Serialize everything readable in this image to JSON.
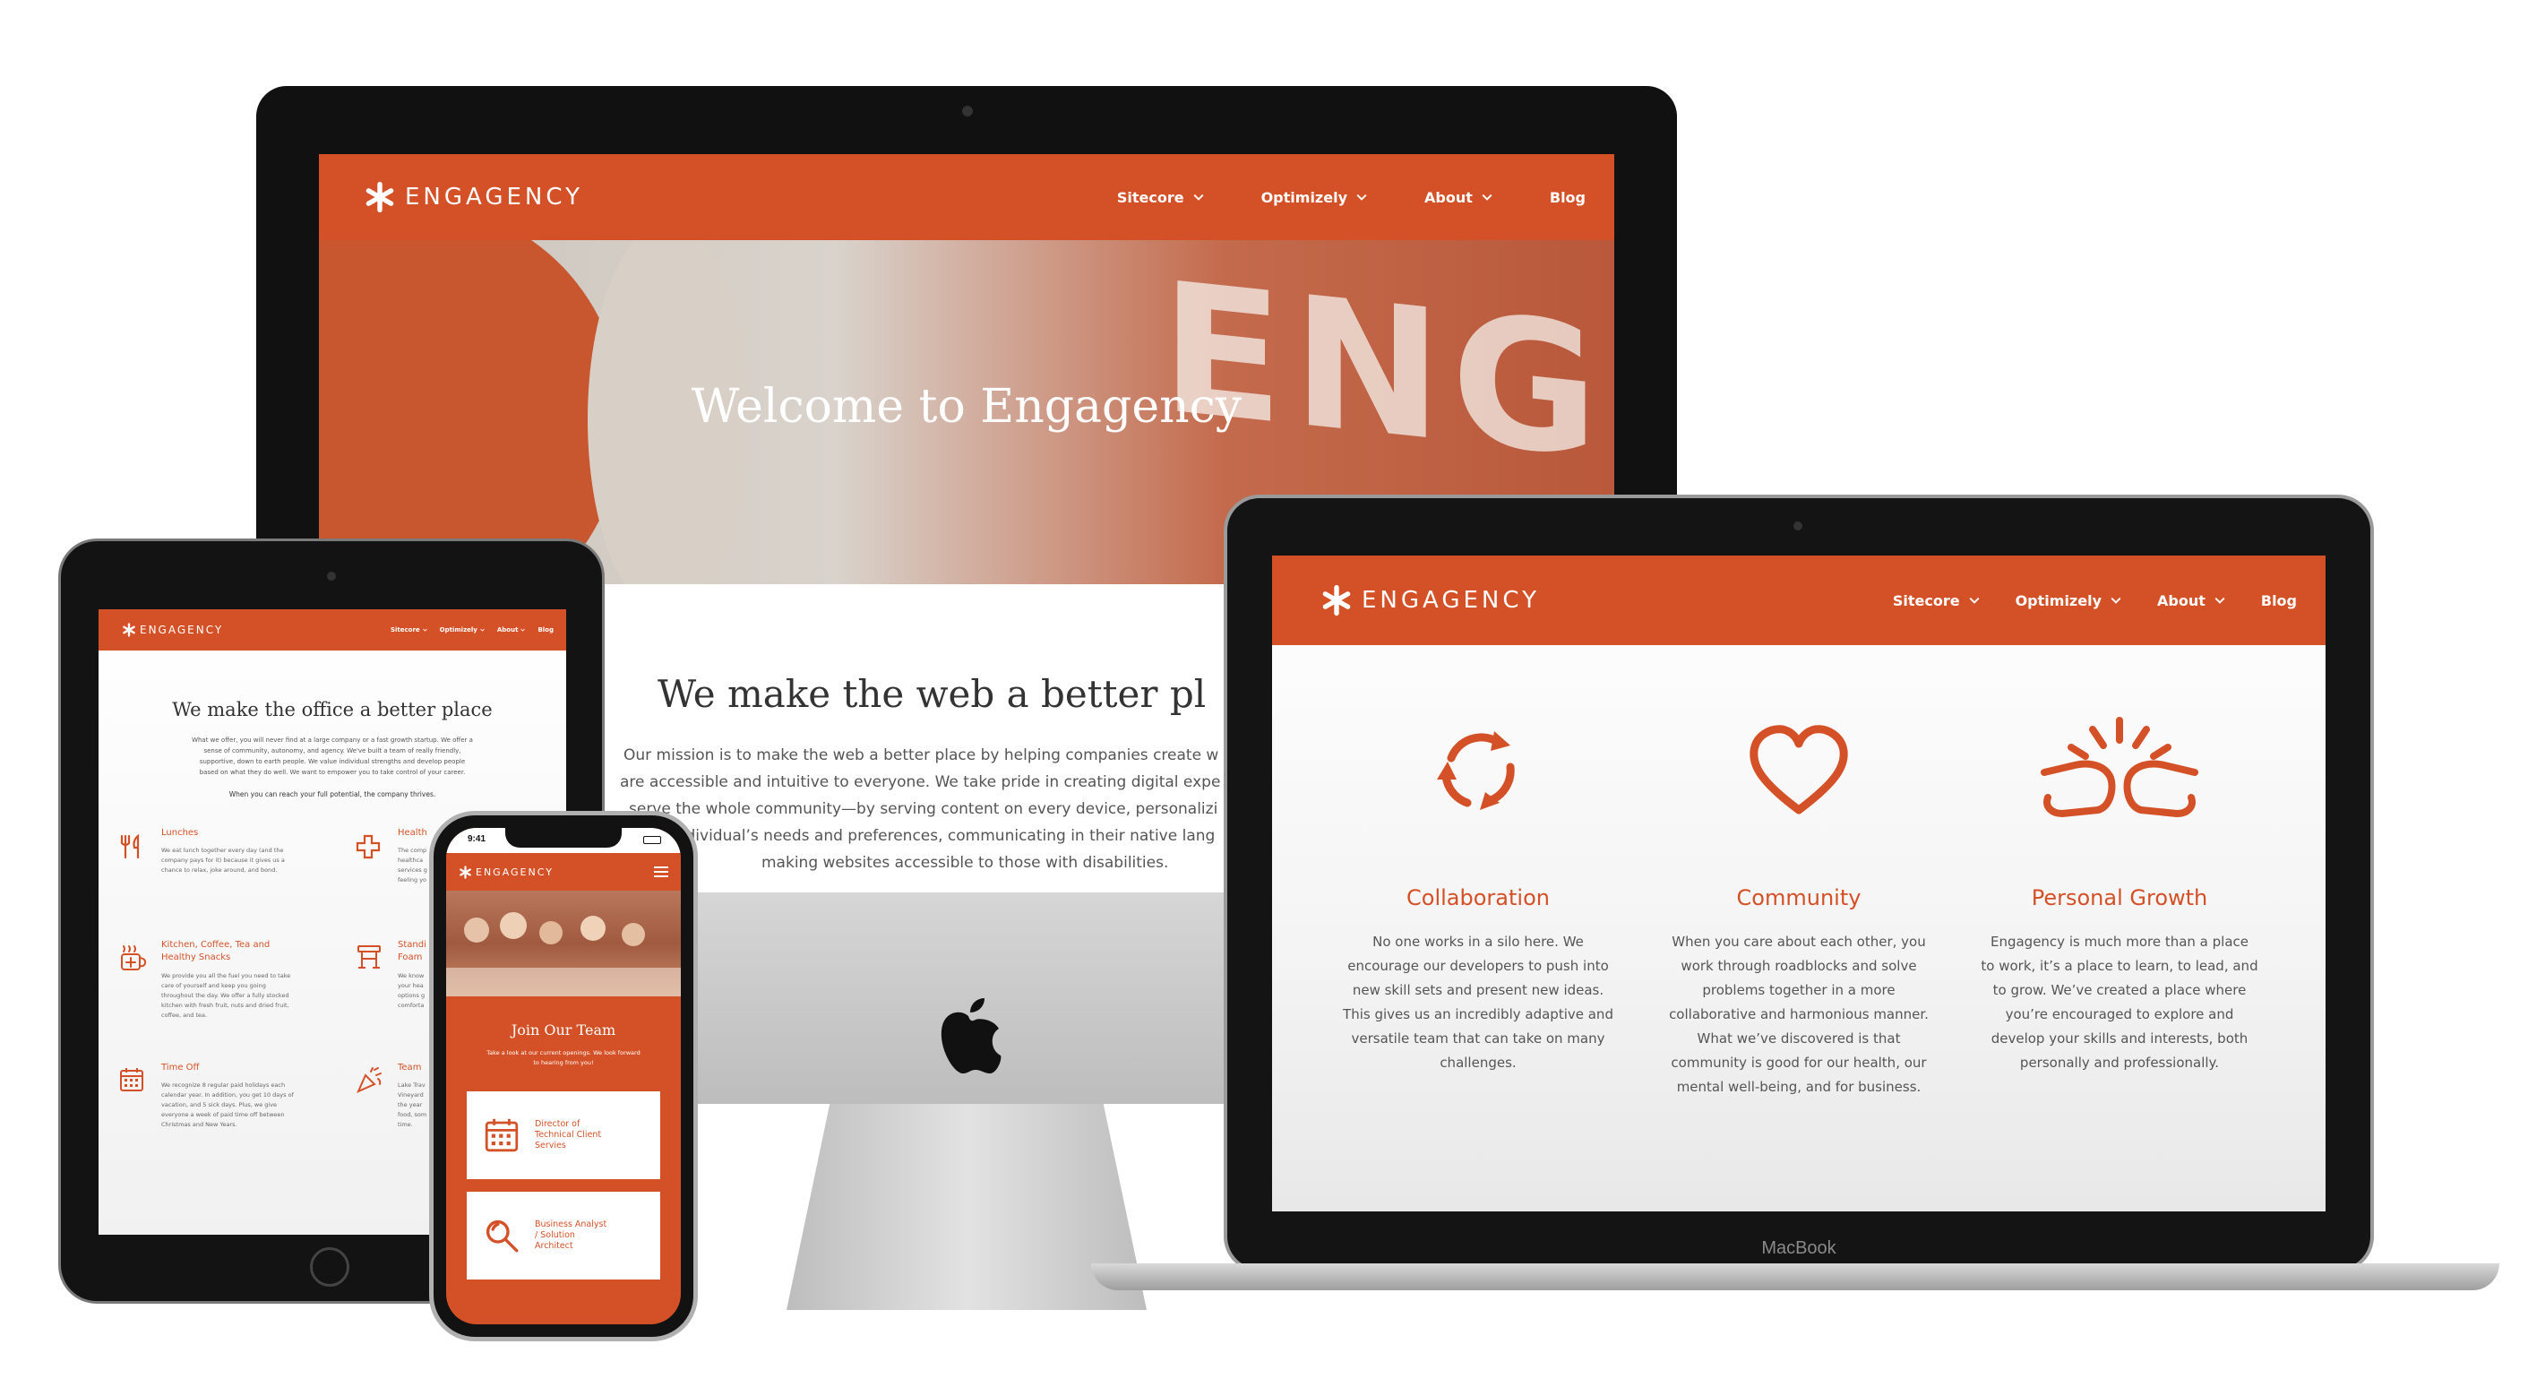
{
  "brand": {
    "name": "ENGAGENCY",
    "accent": "#d45127"
  },
  "desktop": {
    "nav": [
      {
        "label": "Sitecore",
        "dropdown": true
      },
      {
        "label": "Optimizely",
        "dropdown": true
      },
      {
        "label": "About",
        "dropdown": true
      },
      {
        "label": "Blog",
        "dropdown": false
      }
    ],
    "hero_title": "Welcome to Engagency",
    "section_title": "We make the web a better pl",
    "paragraph_lines": [
      "Our mission is to make the web a better place by helping companies create w",
      "are accessible and intuitive to everyone. We take pride in creating digital expe",
      "serve the whole community—by serving content on every device, personalizi",
      "individual’s needs and preferences, communicating in their native lang",
      "making websites accessible to those with disabilities."
    ]
  },
  "laptop": {
    "nav": [
      {
        "label": "Sitecore",
        "dropdown": true
      },
      {
        "label": "Optimizely",
        "dropdown": true
      },
      {
        "label": "About",
        "dropdown": true
      },
      {
        "label": "Blog",
        "dropdown": false
      }
    ],
    "brand_label": "MacBook",
    "features": [
      {
        "icon": "collaboration-icon",
        "title": "Collaboration",
        "text": "No one works in a silo here. We\nencourage our developers to push into\nnew skill sets and present new ideas.\nThis gives us an incredibly adaptive and\nversatile team that can take on many\nchallenges."
      },
      {
        "icon": "heart-icon",
        "title": "Community",
        "text": "When you care about each other, you\nwork through roadblocks and solve\nproblems together in a more\ncollaborative and harmonious manner.\nWhat we’ve discovered is that\ncommunity is good for our health, our\nmental well-being, and for business."
      },
      {
        "icon": "fist-bump-icon",
        "title": "Personal Growth",
        "text": "Engagency is much more than a place\nto work, it’s a place to learn, to lead, and\nto grow. We’ve created a place where\nyou’re encouraged to explore and\ndevelop your skills and interests, both\npersonally and professionally."
      }
    ]
  },
  "tablet": {
    "nav": [
      {
        "label": "Sitecore",
        "dropdown": true
      },
      {
        "label": "Optimizely",
        "dropdown": true
      },
      {
        "label": "About",
        "dropdown": true
      },
      {
        "label": "Blog",
        "dropdown": false
      }
    ],
    "title": "We make the office a better place",
    "intro": "What we offer, you will never find at a large company or a fast growth startup. We offer a\nsense of community, autonomy, and agency. We've built a team of really friendly,\nsupportive, down to earth people. We value individual strengths and develop people\nbased on what they do well. We want to empower you to take control of your career.",
    "tagline": "When you can reach your full potential, the company thrives.",
    "items_left": [
      {
        "icon": "utensils-icon",
        "title": "Lunches",
        "desc": "We eat lunch together every day (and the\ncompany pays for it) because it gives us a\nchance to relax, joke around, and bond."
      },
      {
        "icon": "coffee-icon",
        "title": "Kitchen, Coffee, Tea and\nHealthy Snacks",
        "desc": "We provide you all the fuel you need to take\ncare of yourself and keep you going\nthroughout the day. We offer a fully stocked\nkitchen with fresh fruit, nuts and dried fruit,\ncoffee, and tea."
      },
      {
        "icon": "calendar-icon",
        "title": "Time Off",
        "desc": "We recognize 8 regular paid holidays each\ncalendar year. In addition, you get 10 days of\nvacation, and 5 sick days. Plus, we give\neveryone a week of paid time off between\nChristmas and New Years."
      }
    ],
    "items_right": [
      {
        "icon": "health-cross-icon",
        "title": "Health",
        "desc": "The comp\nhealthca\nservices g\nfeeling yo"
      },
      {
        "icon": "standing-desk-icon",
        "title": "Standi\nFoam",
        "desc": "We know\nyour hea\noptions g\ncomforta"
      },
      {
        "icon": "party-popper-icon",
        "title": "Team",
        "desc": "Lake Trav\nVineyard\nthe year\nfood, som\ntime."
      }
    ]
  },
  "phone": {
    "time": "9:41",
    "section_title": "Join Our Team",
    "section_text": "Take a look at our current openings. We look forward\nto hearing from you!",
    "jobs": [
      {
        "icon": "calendar-icon",
        "label": "Director of\nTechnical Client\nServies"
      },
      {
        "icon": "magnifier-icon",
        "label": "Business Analyst\n/ Solution\nArchitect"
      }
    ]
  }
}
